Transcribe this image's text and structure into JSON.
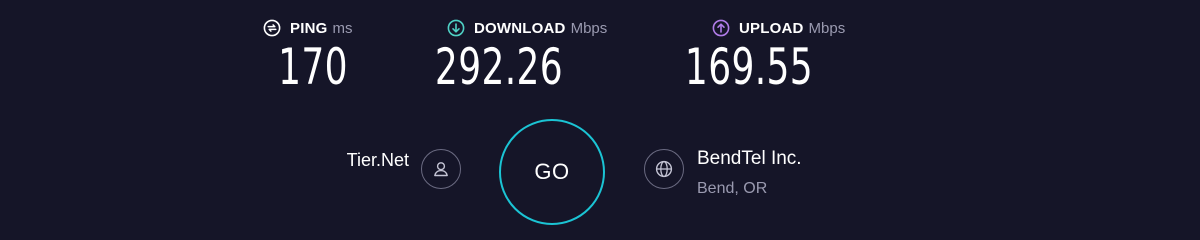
{
  "metrics": {
    "ping": {
      "label": "PING",
      "unit": "ms",
      "value": "170",
      "icon": "ping-icon",
      "icon_color": "#ffffff"
    },
    "download": {
      "label": "DOWNLOAD",
      "unit": "Mbps",
      "value": "292.26",
      "icon": "download-icon",
      "icon_color": "#4fd1c5"
    },
    "upload": {
      "label": "UPLOAD",
      "unit": "Mbps",
      "value": "169.55",
      "icon": "upload-icon",
      "icon_color": "#b07ce8"
    }
  },
  "provider": {
    "name": "Tier.Net",
    "icon": "user-icon"
  },
  "go_button": {
    "label": "GO",
    "ring_color": "#1bc4d4"
  },
  "server": {
    "name": "BendTel Inc.",
    "location": "Bend, OR",
    "icon": "globe-icon"
  },
  "colors": {
    "background": "#151528",
    "muted_text": "#9a9ab0",
    "icon_ring": "#6b6b82"
  }
}
